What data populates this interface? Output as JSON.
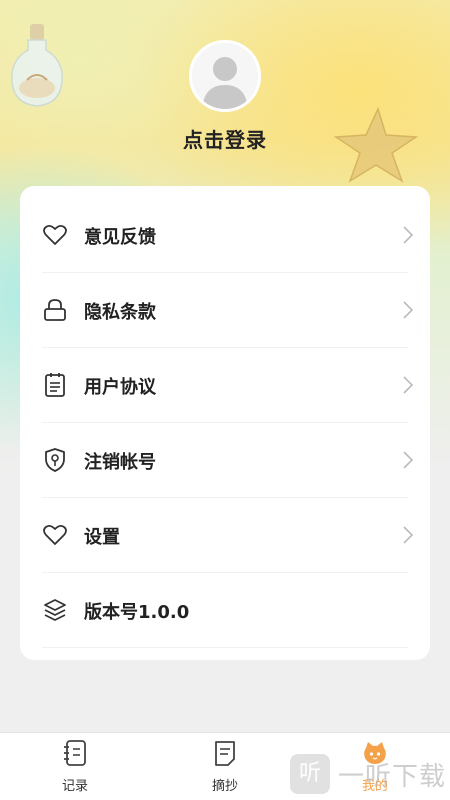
{
  "profile": {
    "login_label": "点击登录"
  },
  "menu": {
    "items": [
      {
        "label": "意见反馈",
        "icon": "heart-icon",
        "chevron": true
      },
      {
        "label": "隐私条款",
        "icon": "lock-icon",
        "chevron": true
      },
      {
        "label": "用户协议",
        "icon": "clipboard-icon",
        "chevron": true
      },
      {
        "label": "注销帐号",
        "icon": "shield-key-icon",
        "chevron": true
      },
      {
        "label": "设置",
        "icon": "heart-icon",
        "chevron": true
      },
      {
        "label": "版本号1.0.0",
        "icon": "layers-icon",
        "chevron": false
      }
    ]
  },
  "tabbar": {
    "tabs": [
      {
        "label": "记录",
        "icon": "notebook-icon",
        "active": false
      },
      {
        "label": "摘抄",
        "icon": "note-icon",
        "active": false
      },
      {
        "label": "我的",
        "icon": "cat-face-icon",
        "active": true
      }
    ]
  },
  "watermark": {
    "logo_glyph": "听",
    "text": "一听下载"
  },
  "colors": {
    "accent": "#f5a14a",
    "text": "#222222",
    "chevron": "#bbbbbb",
    "card": "#ffffff"
  }
}
